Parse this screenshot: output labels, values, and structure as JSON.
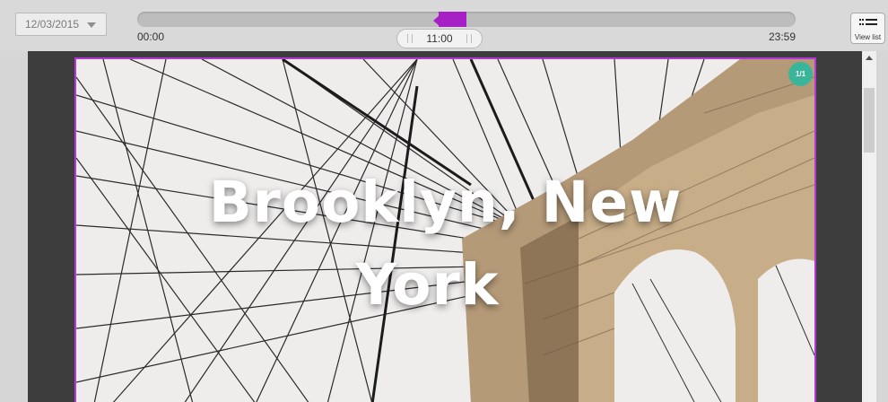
{
  "toolbar": {
    "date": "12/03/2015",
    "timeline": {
      "start_label": "00:00",
      "end_label": "23:59",
      "current_time": "11:00",
      "marker_color": "#a620c6",
      "current_position_fraction": 0.46
    },
    "view_list_label": "View list"
  },
  "slide": {
    "title": "Brooklyn, New York",
    "title_line1": "Brooklyn, New",
    "title_line2": "York",
    "page_indicator": "1/1",
    "badge_color": "#3bb59a",
    "border_color": "#b637d8"
  },
  "icons": {
    "date_dropdown": "chevron-down-icon",
    "view_list": "list-icon",
    "scroll_up": "arrow-up-icon"
  }
}
